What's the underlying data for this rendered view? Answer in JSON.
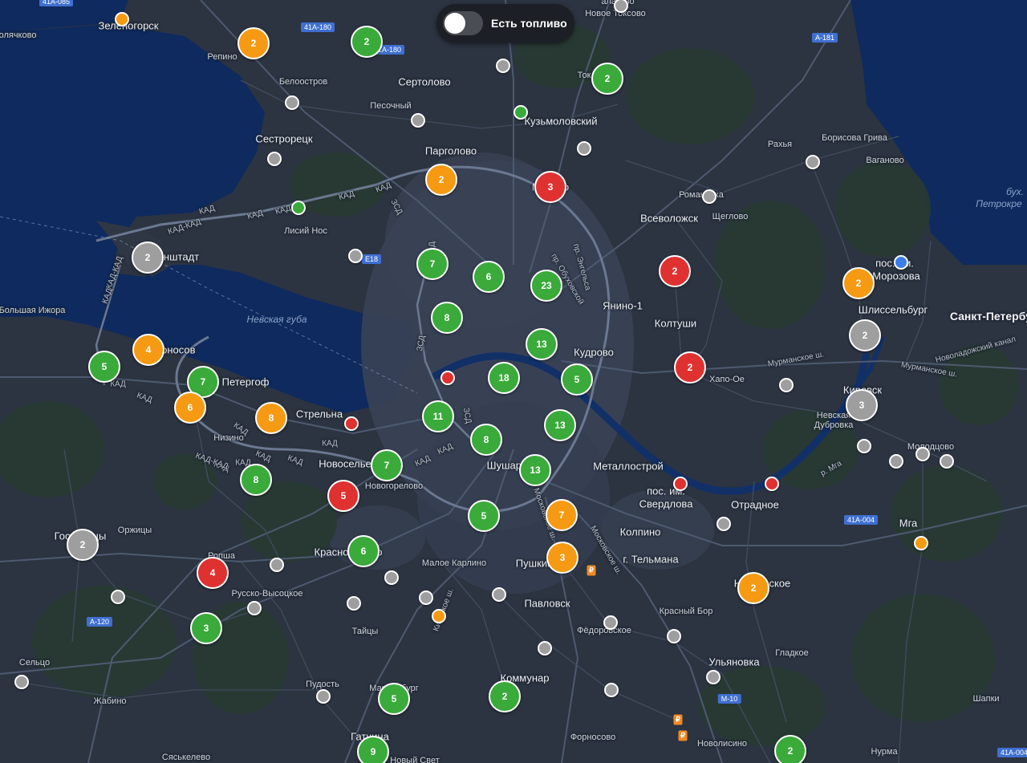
{
  "colors": {
    "green": "#3aaa3a",
    "orange": "#f59a12",
    "red": "#e03131",
    "gray": "#9e9e9e",
    "blue": "#3b7ded"
  },
  "fuel_toggle": {
    "label": "Есть топливо",
    "state": "off"
  },
  "water_labels": [
    {
      "text": "Невская губа"
    },
    {
      "text": "бух."
    },
    {
      "text": "Петрокре"
    }
  ],
  "place_labels": [
    {
      "text": "Санкт-Петербург",
      "cls": "major"
    },
    {
      "text": "Зеленогорск",
      "cls": "city"
    },
    {
      "text": "олячково",
      "cls": "small"
    },
    {
      "text": "Репино",
      "cls": "small"
    },
    {
      "text": "Белоостров",
      "cls": "small"
    },
    {
      "text": "Сертолово",
      "cls": "city"
    },
    {
      "text": "Песочный",
      "cls": "small"
    },
    {
      "text": "Кузьмоловский",
      "cls": "city"
    },
    {
      "text": "Новое Токсово",
      "cls": "small"
    },
    {
      "text": "Ток",
      "cls": "small"
    },
    {
      "text": "алатово",
      "cls": "small"
    },
    {
      "text": "Сестрорецк",
      "cls": "city"
    },
    {
      "text": "Парголово",
      "cls": "city"
    },
    {
      "text": "Мурино",
      "cls": "city"
    },
    {
      "text": "Лисий Нос",
      "cls": "small"
    },
    {
      "text": "Кронштадт",
      "cls": "city"
    },
    {
      "text": "Рахья",
      "cls": "small"
    },
    {
      "text": "Борисова Грива",
      "cls": "small"
    },
    {
      "text": "Ваганово",
      "cls": "small"
    },
    {
      "text": "Романовка",
      "cls": "small"
    },
    {
      "text": "Всеволожск",
      "cls": "city"
    },
    {
      "text": "Щеглово",
      "cls": "small"
    },
    {
      "text": "пос. им.",
      "cls": "city"
    },
    {
      "text": "Морозова",
      "cls": "city"
    },
    {
      "text": "Шлиссельбург",
      "cls": "city"
    },
    {
      "text": "Большая Ижора",
      "cls": "small"
    },
    {
      "text": "Ломоносов",
      "cls": "city"
    },
    {
      "text": "Петергоф",
      "cls": "city"
    },
    {
      "text": "Янино-1",
      "cls": "city"
    },
    {
      "text": "Колтуши",
      "cls": "city"
    },
    {
      "text": "Кудрово",
      "cls": "city"
    },
    {
      "text": "Хапо-Ое",
      "cls": "small"
    },
    {
      "text": "Кировск",
      "cls": "city"
    },
    {
      "text": "Невская",
      "cls": "small"
    },
    {
      "text": "Дубровка",
      "cls": "small"
    },
    {
      "text": "Стрельна",
      "cls": "city"
    },
    {
      "text": "Низино",
      "cls": "small"
    },
    {
      "text": "Новоселье",
      "cls": "city"
    },
    {
      "text": "Новогорелово",
      "cls": "small"
    },
    {
      "text": "Шушары",
      "cls": "city"
    },
    {
      "text": "Металлострой",
      "cls": "city"
    },
    {
      "text": "Молодцово",
      "cls": "small"
    },
    {
      "text": "пос. им.",
      "cls": "city"
    },
    {
      "text": "Свердлова",
      "cls": "city"
    },
    {
      "text": "Отрадное",
      "cls": "city"
    },
    {
      "text": "Мга",
      "cls": "city"
    },
    {
      "text": "Гостилицы",
      "cls": "city"
    },
    {
      "text": "Оржицы",
      "cls": "small"
    },
    {
      "text": "Ропша",
      "cls": "small"
    },
    {
      "text": "Красное Село",
      "cls": "city"
    },
    {
      "text": "Малое Карлино",
      "cls": "small"
    },
    {
      "text": "Пушкин",
      "cls": "city"
    },
    {
      "text": "Колпино",
      "cls": "city"
    },
    {
      "text": "г. Тельмана",
      "cls": "city"
    },
    {
      "text": "Никольское",
      "cls": "city"
    },
    {
      "text": "Русско-Высоцкое",
      "cls": "small"
    },
    {
      "text": "Павловск",
      "cls": "city"
    },
    {
      "text": "Фёдоровское",
      "cls": "small"
    },
    {
      "text": "Красный Бор",
      "cls": "small"
    },
    {
      "text": "Тайцы",
      "cls": "small"
    },
    {
      "text": "Ульяновка",
      "cls": "city"
    },
    {
      "text": "Гладкое",
      "cls": "small"
    },
    {
      "text": "Сельцо",
      "cls": "small"
    },
    {
      "text": "Пудость",
      "cls": "small"
    },
    {
      "text": "Мариенбург",
      "cls": "small"
    },
    {
      "text": "Коммунар",
      "cls": "city"
    },
    {
      "text": "Жабино",
      "cls": "small"
    },
    {
      "text": "Шапки",
      "cls": "small"
    },
    {
      "text": "Гатчина",
      "cls": "city"
    },
    {
      "text": "Форносово",
      "cls": "small"
    },
    {
      "text": "Новолисино",
      "cls": "small"
    },
    {
      "text": "Нурма",
      "cls": "small"
    },
    {
      "text": "Сяськелево",
      "cls": "small"
    },
    {
      "text": "Новый Свет",
      "cls": "small"
    }
  ],
  "road_labels": [
    {
      "text": "КАД"
    },
    {
      "text": "КАД"
    },
    {
      "text": "КАД"
    },
    {
      "text": "КАД-КАД"
    },
    {
      "text": "КАД"
    },
    {
      "text": "КАД"
    },
    {
      "text": "ЗСД"
    },
    {
      "text": "КАД-КАД"
    },
    {
      "text": "КАД"
    },
    {
      "text": "КАД"
    },
    {
      "text": "КАД"
    },
    {
      "text": "КАД"
    },
    {
      "text": "КАД"
    },
    {
      "text": "КАД"
    },
    {
      "text": "КАД-КАД"
    },
    {
      "text": "КАД"
    },
    {
      "text": "КАД"
    },
    {
      "text": "КАД"
    },
    {
      "text": "ЗСД"
    },
    {
      "text": "ЗСД"
    },
    {
      "text": "КАД"
    },
    {
      "text": "КАД"
    },
    {
      "text": "КАД"
    },
    {
      "text": "Мурманское ш."
    },
    {
      "text": "Мурманское ш."
    },
    {
      "text": "Новоладожский канал"
    },
    {
      "text": "Московское ш."
    },
    {
      "text": "Киевское ш."
    },
    {
      "text": "Московское ш."
    },
    {
      "text": "р. Мга"
    },
    {
      "text": "пр. Обуховской"
    },
    {
      "text": "пр. Энгельса"
    }
  ],
  "shields": [
    {
      "text": "41А-085"
    },
    {
      "text": "41А-180"
    },
    {
      "text": "41А-180"
    },
    {
      "text": "А-181"
    },
    {
      "text": "E18"
    },
    {
      "text": "41А-004"
    },
    {
      "text": "А-120"
    },
    {
      "text": "М-10"
    },
    {
      "text": "41А-004"
    }
  ],
  "clusters": [
    {
      "count": "2",
      "color": "orange"
    },
    {
      "count": "2",
      "color": "green"
    },
    {
      "count": "2",
      "color": "green"
    },
    {
      "count": "2",
      "color": "orange"
    },
    {
      "count": "3",
      "color": "red"
    },
    {
      "count": "2",
      "color": "gray"
    },
    {
      "count": "7",
      "color": "green"
    },
    {
      "count": "6",
      "color": "green"
    },
    {
      "count": "23",
      "color": "green"
    },
    {
      "count": "2",
      "color": "red"
    },
    {
      "count": "2",
      "color": "orange"
    },
    {
      "count": "8",
      "color": "green"
    },
    {
      "count": "2",
      "color": "gray"
    },
    {
      "count": "4",
      "color": "orange"
    },
    {
      "count": "5",
      "color": "green"
    },
    {
      "count": "7",
      "color": "green"
    },
    {
      "count": "13",
      "color": "green"
    },
    {
      "count": "2",
      "color": "red"
    },
    {
      "count": "6",
      "color": "orange"
    },
    {
      "count": "8",
      "color": "orange"
    },
    {
      "count": "18",
      "color": "green"
    },
    {
      "count": "5",
      "color": "green"
    },
    {
      "count": "3",
      "color": "gray"
    },
    {
      "count": "11",
      "color": "green"
    },
    {
      "count": "13",
      "color": "green"
    },
    {
      "count": "8",
      "color": "green"
    },
    {
      "count": "7",
      "color": "green"
    },
    {
      "count": "8",
      "color": "green"
    },
    {
      "count": "13",
      "color": "green"
    },
    {
      "count": "5",
      "color": "red"
    },
    {
      "count": "5",
      "color": "green"
    },
    {
      "count": "7",
      "color": "orange"
    },
    {
      "count": "2",
      "color": "gray"
    },
    {
      "count": "6",
      "color": "green"
    },
    {
      "count": "4",
      "color": "red"
    },
    {
      "count": "3",
      "color": "orange"
    },
    {
      "count": "2",
      "color": "orange"
    },
    {
      "count": "3",
      "color": "green"
    },
    {
      "count": "2",
      "color": "green"
    },
    {
      "count": "5",
      "color": "green"
    },
    {
      "count": "9",
      "color": "green"
    },
    {
      "count": "2",
      "color": "green"
    }
  ],
  "stations": [
    {
      "color": "orange"
    },
    {
      "color": "gray"
    },
    {
      "color": "gray"
    },
    {
      "color": "gray"
    },
    {
      "color": "green"
    },
    {
      "color": "gray"
    },
    {
      "color": "gray"
    },
    {
      "color": "gray"
    },
    {
      "color": "green"
    },
    {
      "color": "gray"
    },
    {
      "color": "blue"
    },
    {
      "color": "gray"
    },
    {
      "color": "gray"
    },
    {
      "color": "red"
    },
    {
      "color": "red"
    },
    {
      "color": "red"
    },
    {
      "color": "red"
    },
    {
      "color": "gray"
    },
    {
      "color": "gray"
    },
    {
      "color": "orange"
    },
    {
      "color": "gray"
    },
    {
      "color": "gray"
    },
    {
      "color": "gray"
    },
    {
      "color": "orange"
    },
    {
      "color": "gray"
    },
    {
      "color": "gray"
    },
    {
      "color": "gray"
    },
    {
      "color": "gray"
    },
    {
      "color": "gray"
    },
    {
      "color": "gray"
    },
    {
      "color": "gray"
    },
    {
      "color": "gray"
    },
    {
      "color": "gray"
    },
    {
      "color": "gray"
    },
    {
      "color": "gray"
    },
    {
      "color": "gray"
    },
    {
      "color": "gray"
    },
    {
      "color": "gray"
    },
    {
      "color": "gray"
    }
  ],
  "ruble_markers": [
    {
      "glyph": "₽"
    },
    {
      "glyph": "₽"
    },
    {
      "glyph": "₽"
    }
  ]
}
